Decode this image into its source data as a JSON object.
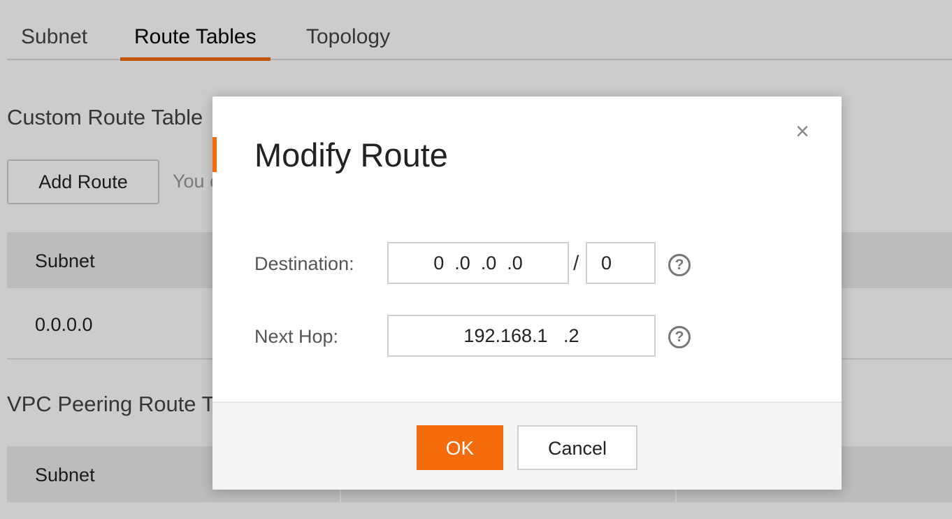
{
  "tabs": [
    {
      "label": "Subnet",
      "active": false
    },
    {
      "label": "Route Tables",
      "active": true
    },
    {
      "label": "Topology",
      "active": false
    }
  ],
  "custom_route_table": {
    "title": "Custom Route Table",
    "add_button": "Add Route",
    "hint": "You c",
    "column_header": "Subnet",
    "rows": [
      {
        "subnet": "0.0.0.0"
      }
    ]
  },
  "vpc_peering_route_table": {
    "title": "VPC Peering Route T",
    "column_header": "Subnet"
  },
  "dialog": {
    "title": "Modify Route",
    "close_icon": "close-icon",
    "destination": {
      "label": "Destination:",
      "ip_value": "0  .0  .0  .0",
      "separator": "/",
      "prefix_value": "0",
      "help_icon": "?"
    },
    "next_hop": {
      "label": "Next Hop:",
      "value": "192.168.1   .2",
      "help_icon": "?"
    },
    "ok_label": "OK",
    "cancel_label": "Cancel"
  },
  "colors": {
    "accent": "#f36b0a",
    "overlay": "rgba(0,0,0,0.2)"
  }
}
